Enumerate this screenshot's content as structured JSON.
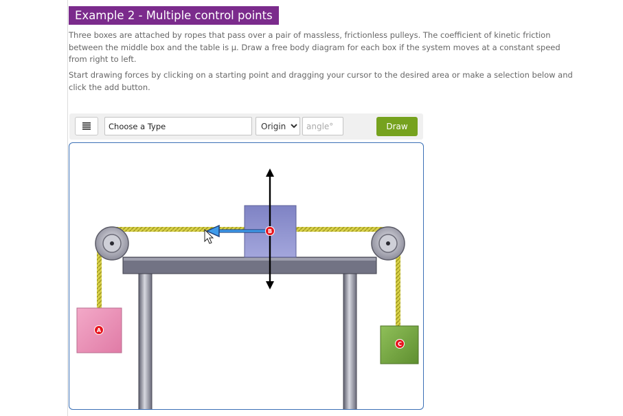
{
  "heading": "Example 2 - Multiple control points",
  "problem_text": "Three boxes are attached by ropes that pass over a pair of massless, frictionless pulleys.  The coefficient of kinetic friction between the middle box and the table is μ.  Draw a free body diagram for each box if the system moves at a constant speed from right to left.",
  "instructions_text": "Start drawing forces by clicking on a starting point and dragging your cursor to the desired area or make a selection below and click the add button.",
  "toolbar": {
    "menu_icon": "hamburger-menu-icon",
    "type_placeholder": "Choose a Type",
    "origin_selected": "Origin",
    "angle_placeholder": "angle°",
    "draw_label": "Draw"
  },
  "diagram": {
    "points": [
      {
        "label": "A",
        "color": "#e8141e"
      },
      {
        "label": "B",
        "color": "#e8141e"
      },
      {
        "label": "C",
        "color": "#e8141e"
      }
    ],
    "colors": {
      "box_a": "#e98cb4",
      "box_b": "#8c8fcc",
      "box_c": "#7cab47",
      "rope": "#c9c23a",
      "table_top": "#6f7080",
      "pulley": "#9a9aa6",
      "force_arrow": "#2a8ae6",
      "axis_arrow": "#000000"
    },
    "cursor_icon": "pointer-cursor-icon"
  }
}
